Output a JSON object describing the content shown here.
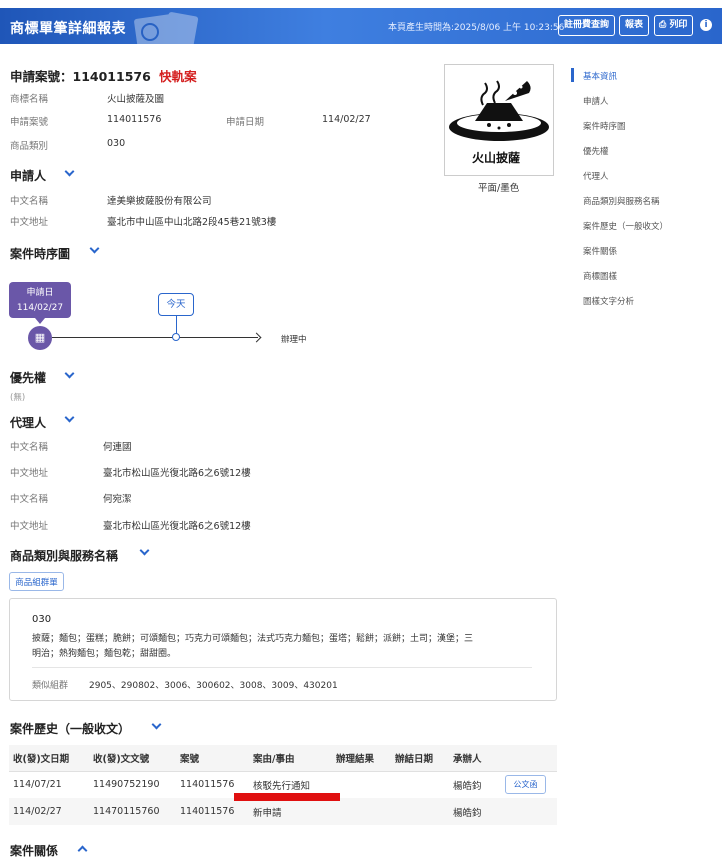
{
  "header": {
    "title": "商標單筆詳細報表",
    "generated": "本頁產生時間為:2025/8/06 上午 10:23:56",
    "buttons": {
      "fee": "註冊費查詢",
      "report": "報表",
      "print": "列印"
    }
  },
  "application": {
    "title_prefix": "申請案號：",
    "number": "114011576",
    "badge": "快軌案",
    "fields": {
      "trademark_name_label": "商標名稱",
      "trademark_name": "火山披薩及圖",
      "app_no_label": "申請案號",
      "app_no": "114011576",
      "app_date_label": "申請日期",
      "app_date": "114/02/27",
      "class_label": "商品類別",
      "class": "030"
    }
  },
  "logo": {
    "text": "火山披薩",
    "caption": "平面/墨色"
  },
  "applicant": {
    "heading": "申請人",
    "name_label": "中文名稱",
    "name": "達美樂披薩股份有限公司",
    "address_label": "中文地址",
    "address": "臺北市中山區中山北路2段45巷21號3樓"
  },
  "timeline": {
    "heading": "案件時序圖",
    "start_label": "申請日",
    "start_date": "114/02/27",
    "today": "今天",
    "status": "辦理中"
  },
  "priority": {
    "heading": "優先權",
    "value": "(無)"
  },
  "agent": {
    "heading": "代理人",
    "name_label": "中文名稱",
    "address_label": "中文地址",
    "list": [
      {
        "name": "何連國",
        "address": "臺北市松山區光復北路6之6號12樓"
      },
      {
        "name": "何宛潔",
        "address": "臺北市松山區光復北路6之6號12樓"
      }
    ]
  },
  "goods": {
    "heading": "商品類別與服務名稱",
    "button": "商品組群單",
    "class": "030",
    "items_line1": "披薩；麵包；蛋糕；脆餅；可頌麵包；巧克力可頌麵包；法式巧克力麵包；蛋塔；鬆餅；派餅；土司；漢堡；三",
    "items_line2": "明治；熱狗麵包；麵包乾；甜甜圈。",
    "similar_label": "類似組群",
    "similar": "2905、290802、3006、300602、3008、3009、430201"
  },
  "history": {
    "heading": "案件歷史（一般收文）",
    "columns": [
      "收(發)文日期",
      "收(發)文文號",
      "案號",
      "案由/事由",
      "辦理結果",
      "辦結日期",
      "承辦人",
      ""
    ],
    "rows": [
      {
        "date": "114/07/21",
        "doc": "11490752190",
        "case": "114011576",
        "reason": "核駁先行通知",
        "result": "",
        "end": "",
        "officer": "楊皓鈞",
        "action": "公文函"
      },
      {
        "date": "114/02/27",
        "doc": "11470115760",
        "case": "114011576",
        "reason": "新申請",
        "result": "",
        "end": "",
        "officer": "楊皓鈞",
        "action": ""
      }
    ]
  },
  "relation": {
    "heading": "案件關係"
  },
  "right_nav": {
    "items": [
      "基本資訊",
      "申請人",
      "案件時序圖",
      "優先權",
      "代理人",
      "商品類別與服務名稱",
      "案件歷史（一般收文）",
      "案件關係",
      "商標圖樣",
      "圖樣文字分析"
    ]
  }
}
